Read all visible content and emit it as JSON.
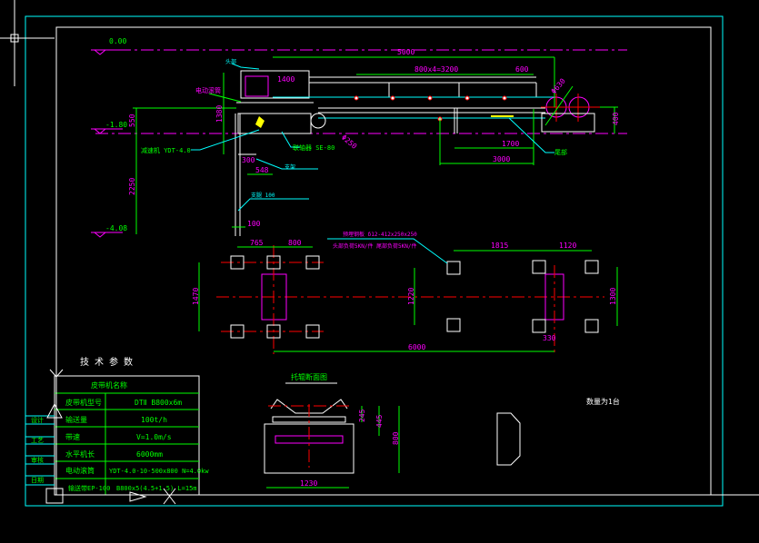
{
  "colors": {
    "background": "#000000",
    "frame": "#ffffff",
    "border": "#00ffff",
    "dimension": "#00ff00",
    "annotation": "#ff00ff",
    "centerline": "#ff0000"
  },
  "elevations": [
    "0.00",
    "-1.80",
    "-4.08"
  ],
  "side_view": {
    "dims": {
      "total": "5000",
      "spacing": "800x4=3200",
      "end": "600",
      "head_width": "1400",
      "d1": "1700",
      "d2": "3000",
      "tail_height": "400",
      "h_total": "2250",
      "h_head": "1380",
      "h_top": "550",
      "w1": "300",
      "w2": "548",
      "base": "100",
      "pulley_dia": "Φ630",
      "drive_dia": "Φ250"
    },
    "labels": {
      "motor": "电动滚筒",
      "head_label": "头部",
      "reducer": "减速机 YDT-4.0",
      "coupling": "联轴器 SE-80",
      "support": "支架",
      "leg": "支腿 100",
      "tail": "尾部"
    }
  },
  "plan_view": {
    "dims": {
      "a": "765",
      "b": "800",
      "c": "1815",
      "d": "1120",
      "h1": "1470",
      "h2": "1220",
      "h3": "1300",
      "total": "6000",
      "offset": "330"
    },
    "notes": [
      "预埋钢板 δ12-412x250x250",
      "头部负荷5KN/件 尾部负荷5KN/件"
    ]
  },
  "section": {
    "title": "托辊断面图",
    "dims": {
      "h1": "245",
      "h2": "445",
      "h3": "800",
      "width": "1230"
    }
  },
  "quantity_note": "数量为1台",
  "tech_table": {
    "title": "技 术 参 数",
    "header": "皮带机名称",
    "rows": [
      {
        "label": "皮带机型号",
        "value": "DTⅡ B800x6m"
      },
      {
        "label": "输送量",
        "value": "100t/h"
      },
      {
        "label": "带速",
        "value": "V=1.0m/s"
      },
      {
        "label": "水平机长",
        "value": "6000mm"
      },
      {
        "label": "电动滚筒",
        "value": "YDT-4.0-10-500x800  N=4.0kw"
      },
      {
        "label": "输送带EP-100",
        "value": "B800x5(4.5+1.5)  L=15m"
      }
    ]
  },
  "side_strip": [
    "设计",
    "工艺",
    "审核",
    "日期"
  ]
}
